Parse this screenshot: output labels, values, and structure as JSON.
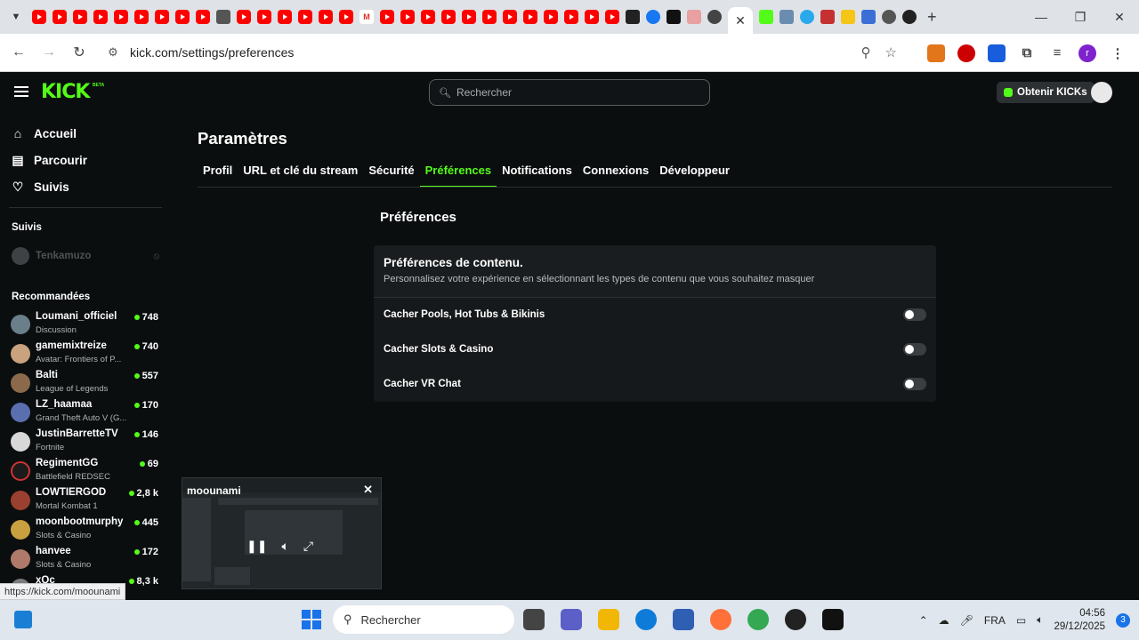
{
  "browser": {
    "url": "kick.com/settings/preferences",
    "hover_status_url": "https://kick.com/moounami",
    "new_tab_glyph": "+",
    "window_controls": [
      "—",
      "❐",
      "✕"
    ]
  },
  "header": {
    "logo": "KICK",
    "logo_badge": "BETA",
    "search_placeholder": "Rechercher",
    "get_kicks_label": "Obtenir KICKs"
  },
  "sidebar": {
    "nav": [
      {
        "label": "Accueil",
        "icon": "home-icon"
      },
      {
        "label": "Parcourir",
        "icon": "browse-icon"
      },
      {
        "label": "Suivis",
        "icon": "heart-icon"
      }
    ],
    "followed_heading": "Suivis",
    "followed": [
      {
        "name": "Tenkamuzo"
      }
    ],
    "recommended_heading": "Recommandées",
    "recommended": [
      {
        "name": "Loumani_officiel",
        "category": "Discussion",
        "viewers": "748",
        "color": "#6b7f8a"
      },
      {
        "name": "gamemixtreize",
        "category": "Avatar: Frontiers of P...",
        "viewers": "740",
        "color": "#c9a27e"
      },
      {
        "name": "Balti",
        "category": "League of Legends",
        "viewers": "557",
        "color": "#8a6a4a"
      },
      {
        "name": "LZ_haamaa",
        "category": "Grand Theft Auto V (G...",
        "viewers": "170",
        "color": "#5a6fb0"
      },
      {
        "name": "JustinBarretteTV",
        "category": "Fortnite",
        "viewers": "146",
        "color": "#d8d8d8"
      },
      {
        "name": "RegimentGG",
        "category": "Battlefield REDSEC",
        "viewers": "69",
        "color": "#1b1b1b"
      },
      {
        "name": "LOWTIERGOD",
        "category": "Mortal Kombat 1",
        "viewers": "2,8 k",
        "color": "#9a4030"
      },
      {
        "name": "moonbootmurphy",
        "category": "Slots & Casino",
        "viewers": "445",
        "color": "#c9a040"
      },
      {
        "name": "hanvee",
        "category": "Slots & Casino",
        "viewers": "172",
        "color": "#b07a6a"
      },
      {
        "name": "xQc",
        "category": "",
        "viewers": "8,3 k",
        "color": "#7a7a7a"
      }
    ]
  },
  "settings": {
    "title": "Paramètres",
    "tabs": [
      "Profil",
      "URL et clé du stream",
      "Sécurité",
      "Préférences",
      "Notifications",
      "Connexions",
      "Développeur"
    ],
    "active_tab": "Préférences",
    "section_title": "Préférences",
    "card_title": "Préférences de contenu.",
    "card_desc": "Personnalisez votre expérience en sélectionnant les types de contenu que vous souhaitez masquer",
    "options": [
      {
        "label": "Cacher Pools, Hot Tubs & Bikinis",
        "enabled": false
      },
      {
        "label": "Cacher Slots & Casino",
        "enabled": false
      },
      {
        "label": "Cacher VR Chat",
        "enabled": false
      }
    ]
  },
  "mini_player": {
    "channel": "moounami"
  },
  "taskbar": {
    "search_placeholder": "Rechercher",
    "language": "FRA",
    "time": "04:56",
    "date": "29/12/2025",
    "notification_count": "3"
  },
  "colors": {
    "accent": "#53fc18",
    "background": "#0b0e0f",
    "card": "#16191b"
  }
}
